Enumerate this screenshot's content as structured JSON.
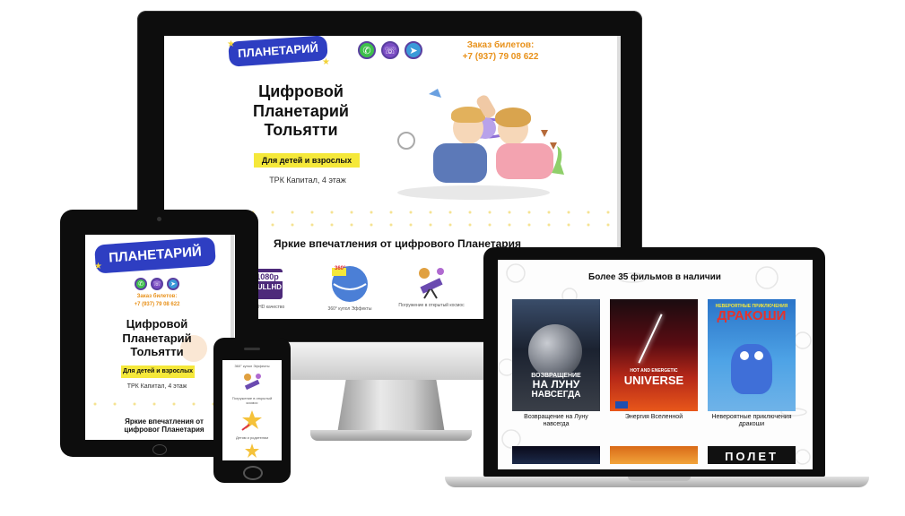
{
  "brand": {
    "logo_text": "ПЛАНЕТАРИЙ",
    "accent_blue": "#2e3ec2",
    "accent_yellow": "#f5e83a",
    "accent_orange": "#e8911a"
  },
  "desktop": {
    "order_label": "Заказ билетов:",
    "phone": "+7 (937) 79 08 622",
    "social_icons": [
      "whatsapp-icon",
      "viber-icon",
      "telegram-icon"
    ],
    "hero_title": [
      "Цифровой",
      "Планетарий",
      "Тольятти"
    ],
    "hero_badge": "Для детей и взрослых",
    "address": "ТРК Капитал, 4 этаж",
    "section_title": "Яркие впечатления от цифрового Планетария",
    "features": [
      {
        "icon": "fullhd-icon",
        "top": "1080p",
        "bottom": "FULLHD",
        "caption": "Full HD качество"
      },
      {
        "icon": "dome-360-icon",
        "top": "360°",
        "caption": "360° купол Эффекты"
      },
      {
        "icon": "telescope-icon",
        "caption": "Погружение в открытый космос"
      }
    ]
  },
  "tablet": {
    "order_label": "Заказ билетов:",
    "phone": "+7 (937) 79 08 622",
    "hero_title": [
      "Цифровой",
      "Планетарий",
      "Тольятти"
    ],
    "hero_badge": "Для детей и взрослых",
    "address": "ТРК Капитал, 4 этаж",
    "section_title": "Яркие впечатления от цифровог Планетария"
  },
  "phone_device": {
    "top_caption": "360° купол Эффекты",
    "mid_caption": "Погружение в открытый космос",
    "bottom_caption": "Детям и родителям"
  },
  "laptop": {
    "section_title": "Более 35 фильмов в наличии",
    "films": [
      {
        "poster_title": [
          "ВОЗВРАЩЕНИЕ",
          "НА ЛУНУ",
          "НАВСЕГДА"
        ],
        "caption": "Возвращение на Луну навсегда"
      },
      {
        "poster_title": [
          "HOT AND ENERGETIC",
          "UNIVERSE"
        ],
        "caption": "Энергия Вселенной"
      },
      {
        "poster_title": [
          "НЕВЕРОЯТНЫЕ ПРИКЛЮЧЕНИЯ",
          "ДРАКОШИ"
        ],
        "caption": "Невероятные приключения дракоши"
      }
    ],
    "next_row_third": "ПОЛЕТ"
  }
}
